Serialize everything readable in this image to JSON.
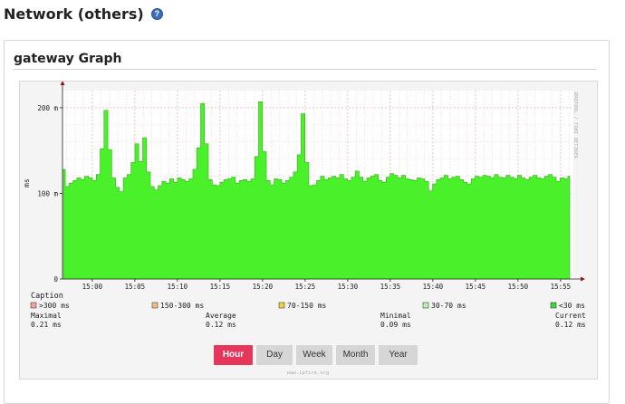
{
  "page": {
    "title": "Network (others)",
    "help_icon": "?"
  },
  "card": {
    "title": "gateway Graph"
  },
  "graph": {
    "y_axis_label": "ms",
    "watermark_side": "RRDTOOL / TOBI OETIKER",
    "watermark_bottom": "www.ipfire.org",
    "caption_title": "Caption",
    "legend": [
      {
        "label": ">300 ms",
        "color": "#f5a0a0"
      },
      {
        "label": "150-300 ms",
        "color": "#f0c080"
      },
      {
        "label": "70-150 ms",
        "color": "#f0d040"
      },
      {
        "label": "30-70 ms",
        "color": "#b8f0b0"
      },
      {
        "label": "<30 ms",
        "color": "#33dd33"
      }
    ],
    "stats": [
      {
        "label": "Maximal",
        "value": "0.21 ms"
      },
      {
        "label": "Average",
        "value": "0.12 ms"
      },
      {
        "label": "Minimal",
        "value": "0.09 ms"
      },
      {
        "label": "Current",
        "value": "0.12 ms"
      }
    ]
  },
  "buttons": [
    {
      "label": "Hour",
      "active": true
    },
    {
      "label": "Day",
      "active": false
    },
    {
      "label": "Week",
      "active": false
    },
    {
      "label": "Month",
      "active": false
    },
    {
      "label": "Year",
      "active": false
    }
  ],
  "chart_data": {
    "type": "area",
    "title": "",
    "xlabel": "",
    "ylabel": "ms",
    "ylim": [
      0,
      220
    ],
    "x_tick_labels": [
      "15:00",
      "15:05",
      "15:10",
      "15:15",
      "15:20",
      "15:25",
      "15:30",
      "15:35",
      "15:40",
      "15:45",
      "15:50",
      "15:55"
    ],
    "y_tick_labels": [
      "0",
      "100 m",
      "200 m"
    ],
    "grid": true,
    "fill_color": "#4af02a",
    "series": [
      {
        "values": [
          128,
          108,
          112,
          115,
          118,
          116,
          120,
          118,
          115,
          122,
          152,
          197,
          151,
          118,
          107,
          102,
          118,
          122,
          136,
          158,
          137,
          165,
          125,
          108,
          104,
          109,
          114,
          112,
          117,
          113,
          118,
          116,
          114,
          117,
          128,
          153,
          205,
          158,
          116,
          110,
          109,
          113,
          116,
          117,
          119,
          112,
          115,
          116,
          114,
          117,
          143,
          207,
          149,
          115,
          110,
          117,
          116,
          112,
          115,
          119,
          125,
          145,
          193,
          136,
          109,
          110,
          115,
          120,
          116,
          118,
          120,
          118,
          122,
          117,
          115,
          119,
          126,
          119,
          114,
          118,
          120,
          122,
          115,
          113,
          119,
          123,
          121,
          118,
          121,
          117,
          116,
          115,
          118,
          117,
          114,
          103,
          111,
          116,
          118,
          121,
          117,
          119,
          120,
          116,
          113,
          111,
          117,
          120,
          119,
          121,
          120,
          118,
          122,
          119,
          118,
          121,
          119,
          117,
          121,
          118,
          116,
          119,
          121,
          118,
          117,
          120,
          122,
          119,
          114,
          118,
          117,
          120
        ]
      }
    ]
  }
}
